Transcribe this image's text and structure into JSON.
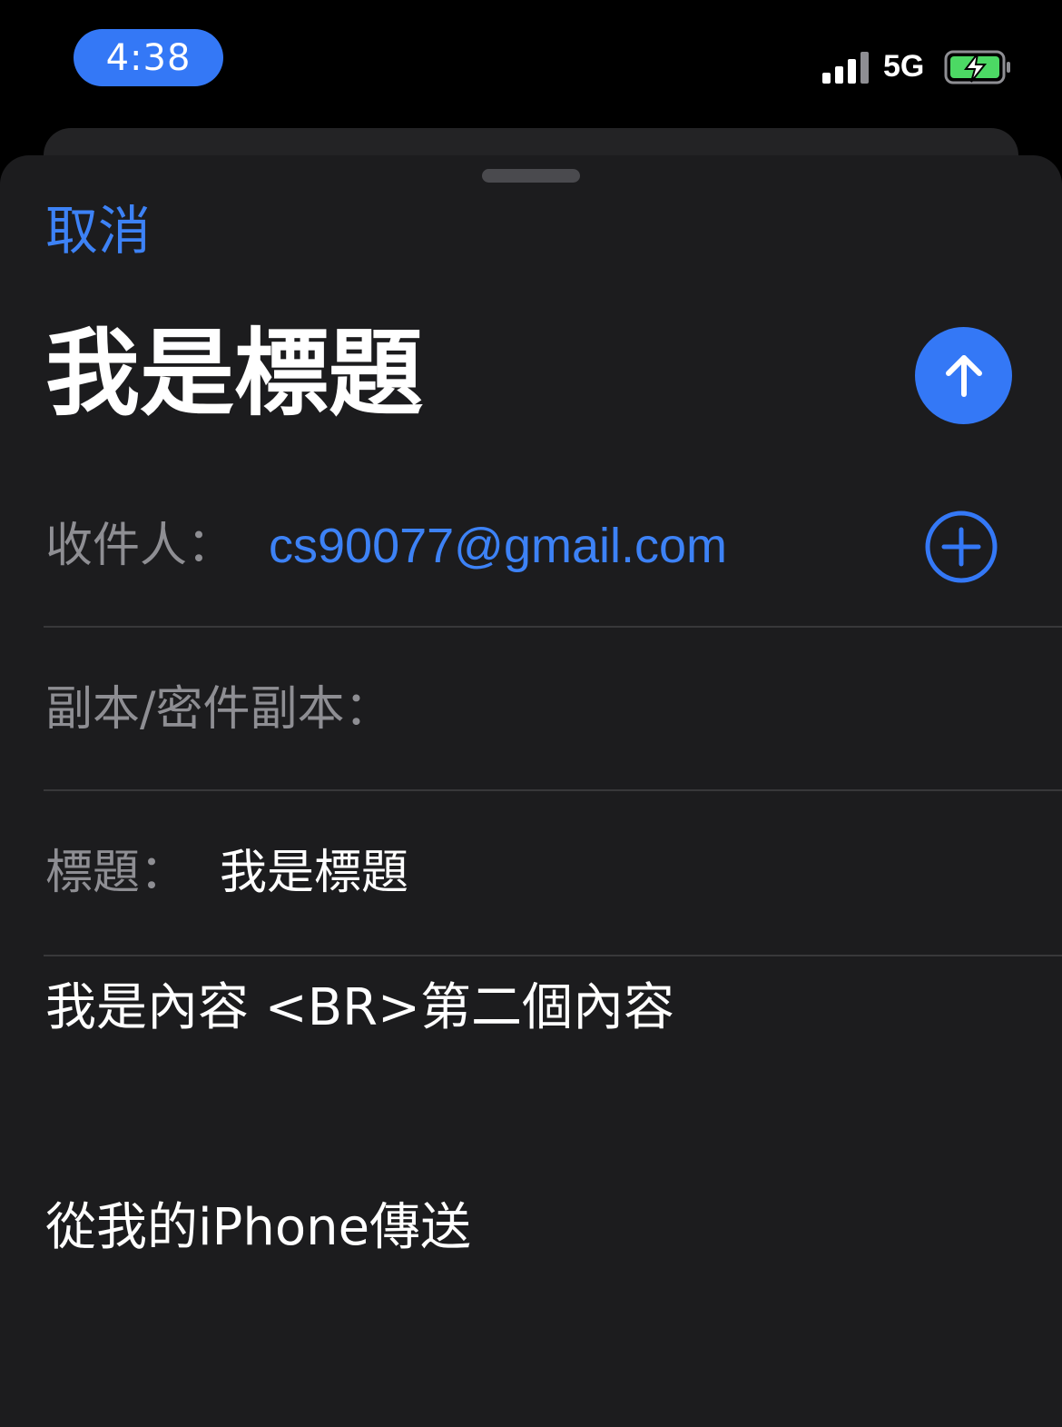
{
  "status_bar": {
    "time": "4:38",
    "network": "5G",
    "signal_icon": "cellular-signal-icon",
    "battery_icon": "battery-charging-icon"
  },
  "compose": {
    "cancel_label": "取消",
    "title": "我是標題",
    "send_icon": "arrow-up-icon",
    "to_label": "收件人：",
    "to_value": "cs90077@gmail.com",
    "add_icon": "plus-circle-icon",
    "cc_label": "副本/密件副本：",
    "subject_label": "標題：",
    "subject_value": "我是標題",
    "body_line": "我是內容 <BR>第二個內容",
    "signature": "從我的iPhone傳送"
  },
  "colors": {
    "accent": "#3478f6",
    "link": "#3d82f6",
    "sheet_bg": "#1c1c1e",
    "label_gray": "#8e8e93",
    "battery_green": "#4cd964"
  }
}
